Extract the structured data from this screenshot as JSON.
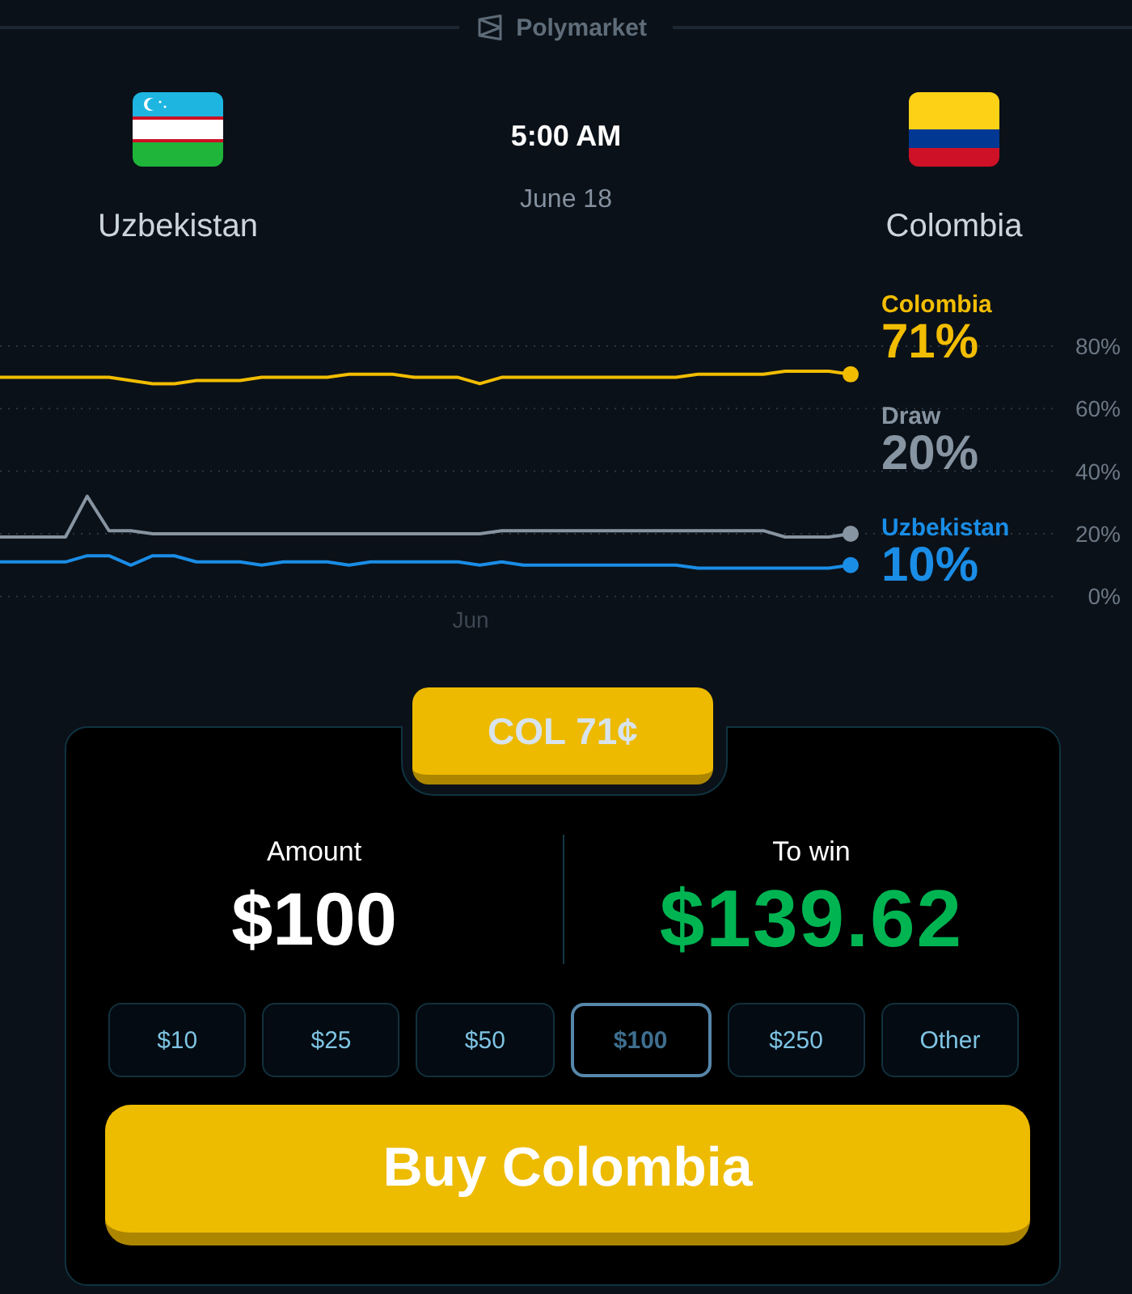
{
  "header": {
    "brand": "Polymarket"
  },
  "match": {
    "teams": [
      {
        "name": "Uzbekistan",
        "kind": "uzbekistan"
      },
      {
        "name": "Colombia",
        "kind": "colombia"
      }
    ],
    "time": "5:00 AM",
    "date": "June 18"
  },
  "chart": {
    "chart_data": {
      "type": "line",
      "grid": true,
      "ylim": [
        0,
        80
      ],
      "yticks": [
        {
          "value": 0,
          "label": "0%"
        },
        {
          "value": 20,
          "label": "20%"
        },
        {
          "value": 40,
          "label": "40%"
        },
        {
          "value": 60,
          "label": "60%"
        },
        {
          "value": 80,
          "label": "80%"
        }
      ],
      "series": [
        {
          "name": "Colombia",
          "color": "#f2bd00",
          "values": [
            70,
            70,
            70,
            70,
            70,
            70,
            69,
            68,
            68,
            69,
            69,
            69,
            70,
            70,
            70,
            70,
            71,
            71,
            71,
            70,
            70,
            70,
            68,
            70,
            70,
            70,
            70,
            70,
            70,
            70,
            70,
            70,
            71,
            71,
            71,
            71,
            72,
            72,
            72,
            71
          ]
        },
        {
          "name": "Draw",
          "color": "#8794a1",
          "values": [
            19,
            19,
            19,
            19,
            32,
            21,
            21,
            20,
            20,
            20,
            20,
            20,
            20,
            20,
            20,
            20,
            20,
            20,
            20,
            20,
            20,
            20,
            20,
            21,
            21,
            21,
            21,
            21,
            21,
            21,
            21,
            21,
            21,
            21,
            21,
            21,
            19,
            19,
            19,
            20
          ]
        },
        {
          "name": "Uzbekistan",
          "color": "#1a8de6",
          "values": [
            11,
            11,
            11,
            11,
            13,
            13,
            10,
            13,
            13,
            11,
            11,
            11,
            10,
            11,
            11,
            11,
            10,
            11,
            11,
            11,
            11,
            11,
            10,
            11,
            10,
            10,
            10,
            10,
            10,
            10,
            10,
            10,
            9,
            9,
            9,
            9,
            9,
            9,
            9,
            10
          ]
        }
      ],
      "value_labels": [
        "71%",
        "20%",
        "10%"
      ],
      "annotations": [
        "Jun"
      ]
    }
  },
  "bet": {
    "outcome_button": "COL 71¢",
    "amount_label": "Amount",
    "amount": "$100",
    "win_label": "To win",
    "win": "$139.62",
    "presets": [
      {
        "label": "$10",
        "selected": false
      },
      {
        "label": "$25",
        "selected": false
      },
      {
        "label": "$50",
        "selected": false
      },
      {
        "label": "$100",
        "selected": true
      },
      {
        "label": "$250",
        "selected": false
      },
      {
        "label": "Other",
        "selected": false
      }
    ],
    "buy_button": "Buy Colombia"
  }
}
